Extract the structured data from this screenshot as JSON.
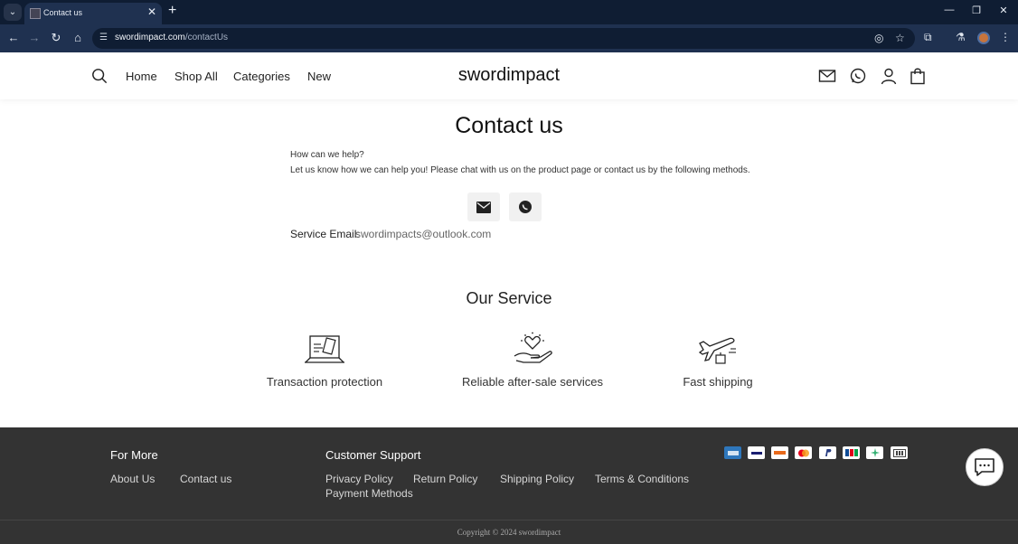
{
  "browser": {
    "tab_title": "Contact us",
    "url_domain": "swordimpact.com",
    "url_path": "/contactUs"
  },
  "header": {
    "brand": "swordimpact",
    "nav": [
      "Home",
      "Shop All",
      "Categories",
      "New"
    ]
  },
  "contact": {
    "title": "Contact us",
    "help_title": "How can we help?",
    "help_text": "Let us know how we can help you! Please chat with us on the product page or contact us by the following methods.",
    "email_label": "Service Email:",
    "email_value": "swordimpacts@outlook.com"
  },
  "service": {
    "heading": "Our Service",
    "items": [
      {
        "label": "Transaction protection",
        "icon": "laptop-shield-icon"
      },
      {
        "label": "Reliable after-sale services",
        "icon": "hand-heart-icon"
      },
      {
        "label": "Fast shipping",
        "icon": "airplane-package-icon"
      }
    ]
  },
  "footer": {
    "for_more": {
      "heading": "For More",
      "links": [
        "About Us",
        "Contact us"
      ]
    },
    "customer_support": {
      "heading": "Customer Support",
      "links": [
        "Privacy Policy",
        "Return Policy",
        "Shipping Policy",
        "Terms & Conditions",
        "Payment Methods"
      ]
    },
    "payment_icons": [
      {
        "name": "amex",
        "color": "#2e77bc"
      },
      {
        "name": "visa",
        "color": "#ffffff"
      },
      {
        "name": "discover",
        "color": "#ffffff"
      },
      {
        "name": "mastercard",
        "color": "#ffffff"
      },
      {
        "name": "paypal",
        "color": "#ffffff"
      },
      {
        "name": "jcb",
        "color": "#ffffff"
      },
      {
        "name": "diners",
        "color": "#ffffff"
      },
      {
        "name": "unionpay",
        "color": "#ffffff"
      }
    ],
    "copyright": "Copyright © 2024 swordimpact"
  }
}
